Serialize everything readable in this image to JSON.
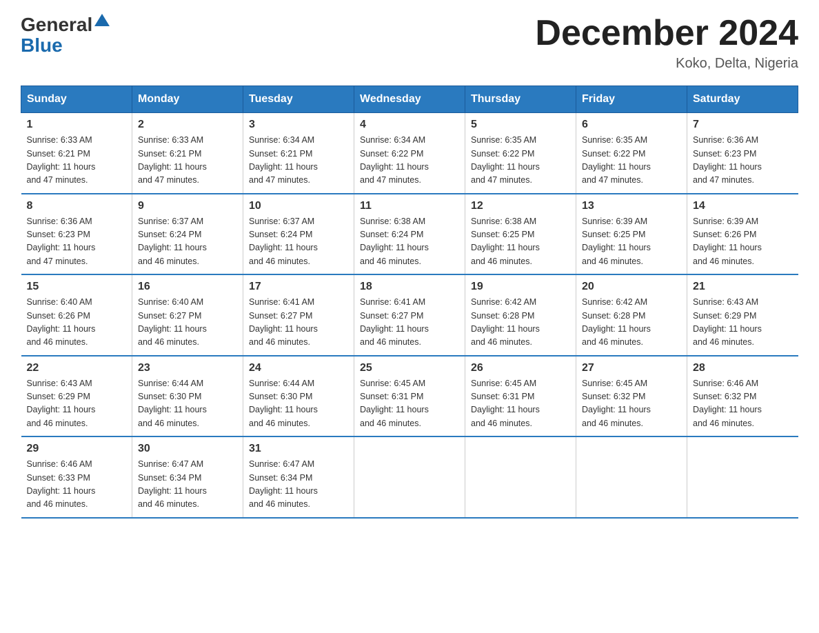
{
  "header": {
    "logo_general": "General",
    "logo_blue": "Blue",
    "month_title": "December 2024",
    "location": "Koko, Delta, Nigeria"
  },
  "days_of_week": [
    "Sunday",
    "Monday",
    "Tuesday",
    "Wednesday",
    "Thursday",
    "Friday",
    "Saturday"
  ],
  "weeks": [
    [
      {
        "day": "1",
        "sunrise": "6:33 AM",
        "sunset": "6:21 PM",
        "daylight": "11 hours and 47 minutes."
      },
      {
        "day": "2",
        "sunrise": "6:33 AM",
        "sunset": "6:21 PM",
        "daylight": "11 hours and 47 minutes."
      },
      {
        "day": "3",
        "sunrise": "6:34 AM",
        "sunset": "6:21 PM",
        "daylight": "11 hours and 47 minutes."
      },
      {
        "day": "4",
        "sunrise": "6:34 AM",
        "sunset": "6:22 PM",
        "daylight": "11 hours and 47 minutes."
      },
      {
        "day": "5",
        "sunrise": "6:35 AM",
        "sunset": "6:22 PM",
        "daylight": "11 hours and 47 minutes."
      },
      {
        "day": "6",
        "sunrise": "6:35 AM",
        "sunset": "6:22 PM",
        "daylight": "11 hours and 47 minutes."
      },
      {
        "day": "7",
        "sunrise": "6:36 AM",
        "sunset": "6:23 PM",
        "daylight": "11 hours and 47 minutes."
      }
    ],
    [
      {
        "day": "8",
        "sunrise": "6:36 AM",
        "sunset": "6:23 PM",
        "daylight": "11 hours and 47 minutes."
      },
      {
        "day": "9",
        "sunrise": "6:37 AM",
        "sunset": "6:24 PM",
        "daylight": "11 hours and 46 minutes."
      },
      {
        "day": "10",
        "sunrise": "6:37 AM",
        "sunset": "6:24 PM",
        "daylight": "11 hours and 46 minutes."
      },
      {
        "day": "11",
        "sunrise": "6:38 AM",
        "sunset": "6:24 PM",
        "daylight": "11 hours and 46 minutes."
      },
      {
        "day": "12",
        "sunrise": "6:38 AM",
        "sunset": "6:25 PM",
        "daylight": "11 hours and 46 minutes."
      },
      {
        "day": "13",
        "sunrise": "6:39 AM",
        "sunset": "6:25 PM",
        "daylight": "11 hours and 46 minutes."
      },
      {
        "day": "14",
        "sunrise": "6:39 AM",
        "sunset": "6:26 PM",
        "daylight": "11 hours and 46 minutes."
      }
    ],
    [
      {
        "day": "15",
        "sunrise": "6:40 AM",
        "sunset": "6:26 PM",
        "daylight": "11 hours and 46 minutes."
      },
      {
        "day": "16",
        "sunrise": "6:40 AM",
        "sunset": "6:27 PM",
        "daylight": "11 hours and 46 minutes."
      },
      {
        "day": "17",
        "sunrise": "6:41 AM",
        "sunset": "6:27 PM",
        "daylight": "11 hours and 46 minutes."
      },
      {
        "day": "18",
        "sunrise": "6:41 AM",
        "sunset": "6:27 PM",
        "daylight": "11 hours and 46 minutes."
      },
      {
        "day": "19",
        "sunrise": "6:42 AM",
        "sunset": "6:28 PM",
        "daylight": "11 hours and 46 minutes."
      },
      {
        "day": "20",
        "sunrise": "6:42 AM",
        "sunset": "6:28 PM",
        "daylight": "11 hours and 46 minutes."
      },
      {
        "day": "21",
        "sunrise": "6:43 AM",
        "sunset": "6:29 PM",
        "daylight": "11 hours and 46 minutes."
      }
    ],
    [
      {
        "day": "22",
        "sunrise": "6:43 AM",
        "sunset": "6:29 PM",
        "daylight": "11 hours and 46 minutes."
      },
      {
        "day": "23",
        "sunrise": "6:44 AM",
        "sunset": "6:30 PM",
        "daylight": "11 hours and 46 minutes."
      },
      {
        "day": "24",
        "sunrise": "6:44 AM",
        "sunset": "6:30 PM",
        "daylight": "11 hours and 46 minutes."
      },
      {
        "day": "25",
        "sunrise": "6:45 AM",
        "sunset": "6:31 PM",
        "daylight": "11 hours and 46 minutes."
      },
      {
        "day": "26",
        "sunrise": "6:45 AM",
        "sunset": "6:31 PM",
        "daylight": "11 hours and 46 minutes."
      },
      {
        "day": "27",
        "sunrise": "6:45 AM",
        "sunset": "6:32 PM",
        "daylight": "11 hours and 46 minutes."
      },
      {
        "day": "28",
        "sunrise": "6:46 AM",
        "sunset": "6:32 PM",
        "daylight": "11 hours and 46 minutes."
      }
    ],
    [
      {
        "day": "29",
        "sunrise": "6:46 AM",
        "sunset": "6:33 PM",
        "daylight": "11 hours and 46 minutes."
      },
      {
        "day": "30",
        "sunrise": "6:47 AM",
        "sunset": "6:34 PM",
        "daylight": "11 hours and 46 minutes."
      },
      {
        "day": "31",
        "sunrise": "6:47 AM",
        "sunset": "6:34 PM",
        "daylight": "11 hours and 46 minutes."
      },
      null,
      null,
      null,
      null
    ]
  ],
  "labels": {
    "sunrise_prefix": "Sunrise: ",
    "sunset_prefix": "Sunset: ",
    "daylight_prefix": "Daylight: "
  }
}
